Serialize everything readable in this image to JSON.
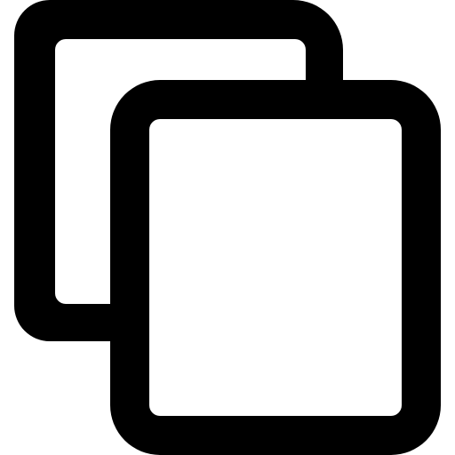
{
  "icon": {
    "name": "copy-icon",
    "stroke_color": "#000000",
    "fill_color": "#ffffff",
    "background": "#ffffff"
  }
}
